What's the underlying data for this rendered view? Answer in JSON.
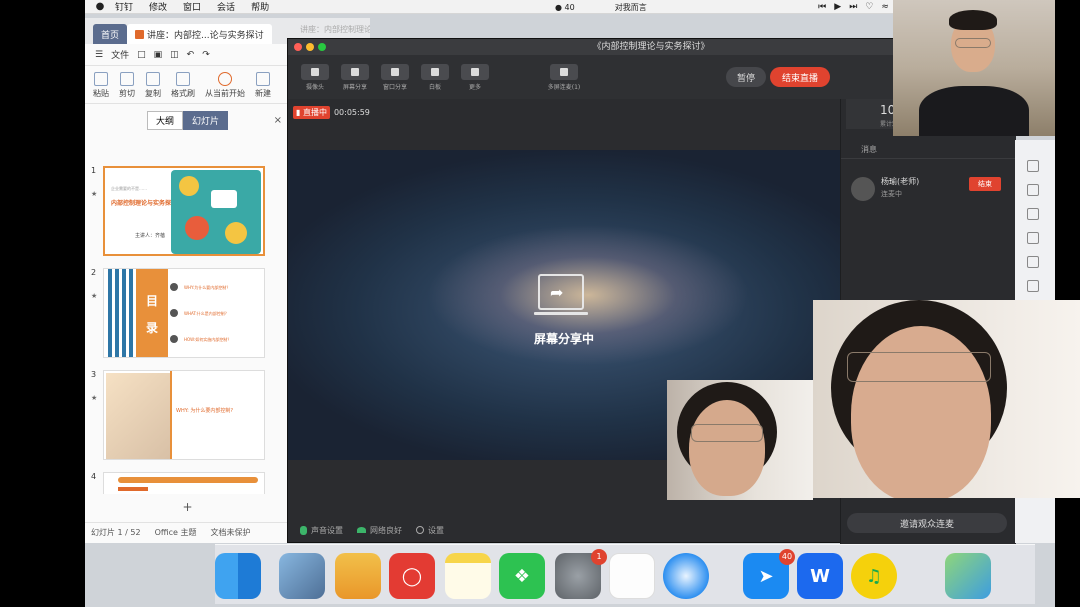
{
  "menubar": {
    "apple_icon": "apple-icon",
    "items": [
      "钉钉",
      "修改",
      "窗口",
      "会话",
      "帮助"
    ],
    "badge_count": "40",
    "center_text": "对我而言"
  },
  "wps": {
    "tab_home": "首页",
    "tab_doc": "讲座：内部控...论与实务探讨",
    "menu_file": "文件",
    "tools": [
      "粘贴",
      "剪切",
      "复制",
      "格式刷",
      "从当前开始",
      "新建"
    ],
    "outline_tab": "大纲",
    "slides_tab": "幻灯片",
    "close": "×",
    "slide_numbers": [
      "1",
      "2",
      "3",
      "4"
    ],
    "slide1_pre": "企业需要的不是……",
    "slide1_title": "内部控制理论与实务探讨",
    "slide1_sub": "主讲人：齐蓓",
    "slide2_chars": [
      "目",
      "录"
    ],
    "slide2_items": [
      "WHY:为什么要内部控制？",
      "WHAT:什么是内部控制？",
      "HOW:如何实施内部控制？"
    ],
    "slide3_q": "WHY: 为什么要内部控制?",
    "add": "+",
    "status_slide": "幻灯片 1 / 52",
    "status_theme": "Office 主题",
    "status_protect": "文档未保护"
  },
  "behind_title": "讲座：内部控制理论与实务探讨.pptx",
  "live": {
    "window_title": "《内部控制理论与实务探讨》",
    "toolbar": [
      "摄像头",
      "屏幕分享",
      "窗口分享",
      "白板",
      "更多",
      "多屏连麦(1)"
    ],
    "pause": "暂停",
    "end_live": "结束直播",
    "live_badge": "直播中",
    "timer": "00:05:59",
    "share_text": "屏幕分享中",
    "bottom": [
      "声音设置",
      "网络良好",
      "设置"
    ],
    "viewer_count": "10",
    "viewer_label": "累计观看",
    "tab_messages": "消息",
    "speaker_name": "杨瑜(老师)",
    "speaker_status": "连麦中",
    "speaker_end": "结束",
    "invite": "邀请观众连麦"
  },
  "dock": {
    "apps": [
      "finder",
      "preview",
      "folder",
      "netease-music",
      "notes",
      "wechat",
      "system-preferences",
      "reminders",
      "safari",
      "dingtalk",
      "wps",
      "qq-music",
      "maps"
    ],
    "badge_sysprefs": "1",
    "badge_dingtalk": "40"
  }
}
